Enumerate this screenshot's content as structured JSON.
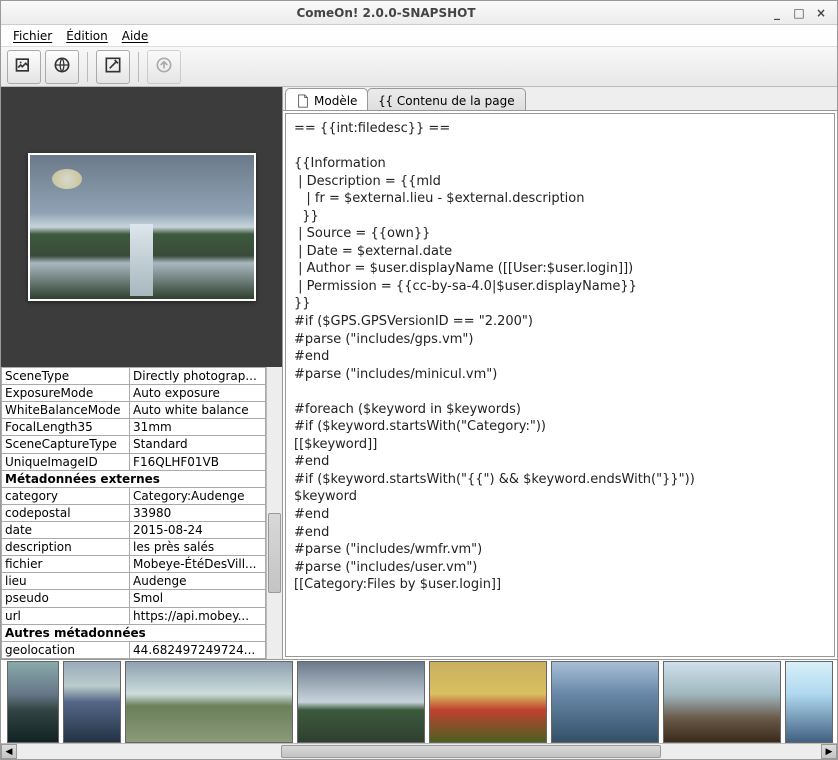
{
  "window": {
    "title": "ComeOn! 2.0.0-SNAPSHOT"
  },
  "menu": {
    "file": "Fichier",
    "edit": "Édition",
    "help": "Aide"
  },
  "tabs": {
    "model": "Modèle",
    "content": "Contenu de la page"
  },
  "editor_text": "== {{int:filedesc}} ==\n\n{{Information\n | Description = {{mld\n   | fr = $external.lieu - $external.description\n  }}\n | Source = {{own}}\n | Date = $external.date\n | Author = $user.displayName ([[User:$user.login]])\n | Permission = {{cc-by-sa-4.0|$user.displayName}}\n}}\n#if ($GPS.GPSVersionID == \"2.200\")\n#parse (\"includes/gps.vm\")\n#end\n#parse (\"includes/minicul.vm\")\n\n#foreach ($keyword in $keywords)\n#if ($keyword.startsWith(\"Category:\"))\n[[$keyword]]\n#end\n#if ($keyword.startsWith(\"{{\") && $keyword.endsWith(\"}}\"))\n$keyword\n#end\n#end\n#parse (\"includes/wmfr.vm\")\n#parse (\"includes/user.vm\")\n[[Category:Files by $user.login]]",
  "meta_rows": [
    {
      "k": "SceneType",
      "v": "Directly photograp..."
    },
    {
      "k": "ExposureMode",
      "v": "Auto exposure"
    },
    {
      "k": "WhiteBalanceMode",
      "v": "Auto white balance"
    },
    {
      "k": "FocalLength35",
      "v": "31mm"
    },
    {
      "k": "SceneCaptureType",
      "v": "Standard"
    },
    {
      "k": "UniqueImageID",
      "v": "F16QLHF01VB"
    }
  ],
  "meta_section1": "Métadonnées externes",
  "meta_ext": [
    {
      "k": "category",
      "v": "Category:Audenge"
    },
    {
      "k": "codepostal",
      "v": "33980"
    },
    {
      "k": "date",
      "v": "2015-08-24"
    },
    {
      "k": "description",
      "v": "les près salés"
    },
    {
      "k": "fichier",
      "v": "Mobeye-ÉtéDesVill..."
    },
    {
      "k": "lieu",
      "v": "Audenge"
    },
    {
      "k": "pseudo",
      "v": "Smol"
    },
    {
      "k": "url",
      "v": "https://api.mobey..."
    }
  ],
  "meta_section2": "Autres métadonnées",
  "meta_other": [
    {
      "k": "geolocation",
      "v": "44.682497249724..."
    }
  ]
}
